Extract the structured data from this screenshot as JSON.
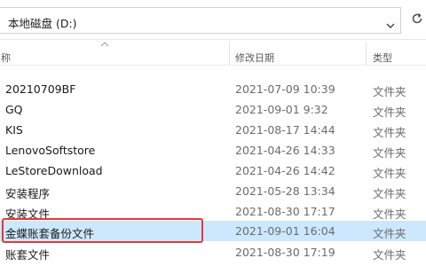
{
  "address_bar": {
    "path": "本地磁盘 (D:)"
  },
  "columns": {
    "name": "称",
    "date_modified": "修改日期",
    "type": "类型"
  },
  "rows": [
    {
      "name": "20210709BF",
      "date": "2021-07-09 10:39",
      "type": "文件夹"
    },
    {
      "name": "GQ",
      "date": "2021-09-01 9:32",
      "type": "文件夹"
    },
    {
      "name": "KIS",
      "date": "2021-08-17 14:44",
      "type": "文件夹"
    },
    {
      "name": "LenovoSoftstore",
      "date": "2021-04-26 14:33",
      "type": "文件夹"
    },
    {
      "name": "LeStoreDownload",
      "date": "2021-04-26 14:42",
      "type": "文件夹"
    },
    {
      "name": "安装程序",
      "date": "2021-05-28 13:34",
      "type": "文件夹"
    },
    {
      "name": "安装文件",
      "date": "2021-08-30 17:17",
      "type": "文件夹"
    },
    {
      "name": "金蝶账套备份文件",
      "date": "2021-09-01 16:04",
      "type": "文件夹"
    },
    {
      "name": "账套文件",
      "date": "2021-08-30 17:19",
      "type": "文件夹"
    }
  ],
  "highlight_color": "#e53935",
  "selection_color": "#cce8ff"
}
